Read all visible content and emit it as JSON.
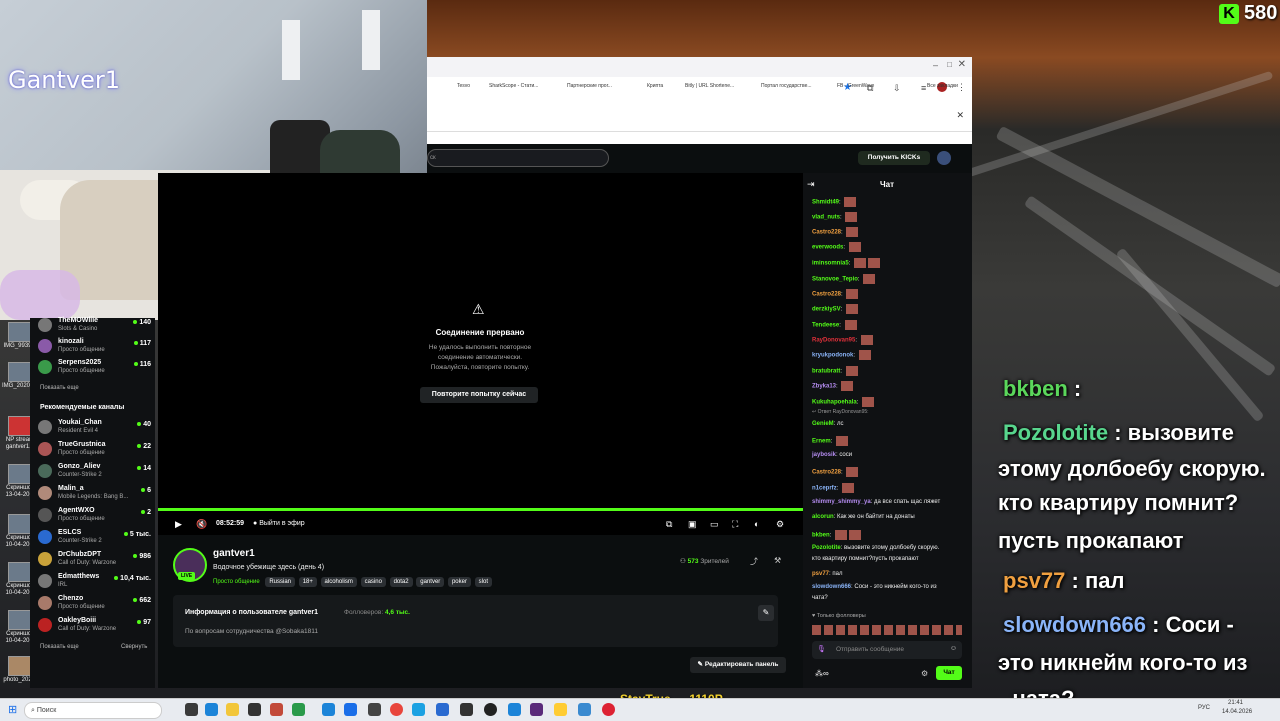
{
  "overlay": {
    "streamer_name": "Gantver1",
    "kick_counter": "580",
    "ticker_text": "StayTrue — 1110P",
    "chat": [
      {
        "user": "bkben",
        "sep": " : ",
        "text": "",
        "color": "#5bd75b"
      },
      {
        "user": "Pozolotite",
        "sep": " : ",
        "text": "вызовите",
        "color": "#58d68d"
      },
      {
        "user": "",
        "sep": "",
        "text": "этому долбоебу скорую.",
        "color": "#ffffff"
      },
      {
        "user": "",
        "sep": "",
        "text": "кто квартиру помнит?",
        "color": "#ffffff"
      },
      {
        "user": "",
        "sep": "",
        "text": "пусть прокапают",
        "color": "#ffffff"
      },
      {
        "user": "psv77",
        "sep": " : ",
        "text": "пал",
        "color": "#f0a040"
      },
      {
        "user": "slowdown666",
        "sep": " : ",
        "text": "Соси -",
        "color": "#8ab4f8"
      },
      {
        "user": "",
        "sep": "",
        "text": "это никнейм кого-то из",
        "color": "#ffffff"
      },
      {
        "user": "",
        "sep": "",
        "text": "чата?",
        "color": "#ffffff"
      }
    ]
  },
  "desktop_icons": [
    "IMG_9939...",
    "IMG_20200...",
    "NP stream gantver1...",
    "Скриншот 13-04-20...",
    "Скриншот 10-04-20...",
    "Скриншот 10-04-20...",
    "Скриншот 10-04-20...",
    "photo_202..."
  ],
  "browser": {
    "bookmarks": [
      "Tesvo",
      "SharkScope - Стати...",
      "Партнерские прог...",
      "Крипта",
      "Bitly | URL Shortene...",
      "Портал государстве...",
      "FB - GreenWave",
      "Все закладки"
    ],
    "search_placeholder": "ск",
    "get_kicks_button": "Получить KICKs"
  },
  "sidebar": {
    "channels_top": [
      {
        "name": "TheMOWliie",
        "category": "Slots & Casino",
        "viewers": "140"
      },
      {
        "name": "kinozali",
        "category": "Просто общение",
        "viewers": "117"
      },
      {
        "name": "Serpens2025",
        "category": "Просто общение",
        "viewers": "116"
      }
    ],
    "show_more": "Показать еще",
    "recommended_title": "Рекомендуемые каналы",
    "recommended": [
      {
        "name": "Youkai_Chan",
        "category": "Resident Evil 4",
        "viewers": "40"
      },
      {
        "name": "TrueGrustnica",
        "category": "Просто общение",
        "viewers": "22"
      },
      {
        "name": "Gonzo_Aliev",
        "category": "Counter-Strike 2",
        "viewers": "14"
      },
      {
        "name": "Malin_a",
        "category": "Mobile Legends: Bang B...",
        "viewers": "6"
      },
      {
        "name": "AgentWXO",
        "category": "Просто общение",
        "viewers": "2"
      },
      {
        "name": "ESLCS",
        "category": "Counter-Strike 2",
        "viewers": "5 тыс."
      },
      {
        "name": "DrChubzDPT",
        "category": "Call of Duty: Warzone",
        "viewers": "986"
      },
      {
        "name": "Edmatthews",
        "category": "IRL",
        "viewers": "10,4 тыс."
      },
      {
        "name": "Chenzo",
        "category": "Просто общение",
        "viewers": "662"
      },
      {
        "name": "OakleyBoiii",
        "category": "Call of Duty: Warzone",
        "viewers": "97"
      }
    ],
    "show_more_2": "Показать еще",
    "collapse": "Свернуть"
  },
  "player": {
    "error_title": "Соединение прервано",
    "error_body": [
      "Не удалось выполнить повторное",
      "соединение автоматически.",
      "Пожалуйста, повторите попытку."
    ],
    "retry_button": "Повторите попытку сейчас",
    "time": "08:52:59",
    "go_live": "Выйти в эфир"
  },
  "stream_info": {
    "channel": "gantver1",
    "title": "Водочное убежище здесь (день 4)",
    "live_badge": "LIVE",
    "category": "Просто общение",
    "tags": [
      "Russian",
      "18+",
      "alcoholism",
      "casino",
      "dota2",
      "gantver",
      "poker",
      "slot"
    ],
    "viewers": "573",
    "viewers_label": "Зрителей"
  },
  "about": {
    "title": "Информация о пользователе gantver1",
    "followers_label": "Фолловеров:",
    "followers": "4,6 тыс.",
    "desc": "По вопросам сотрудничества @Sobaka1811",
    "edit_panel": "Редактировать панель"
  },
  "chat": {
    "title": "Чат",
    "messages": [
      {
        "user": "Shmidt49",
        "text": "",
        "color": "#53fc18"
      },
      {
        "user": "vlad_nuts",
        "text": "",
        "color": "#53fc18"
      },
      {
        "user": "Castro228",
        "text": "",
        "color": "#f0a040"
      },
      {
        "user": "everwoods",
        "text": "",
        "color": "#53fc18"
      },
      {
        "user": "iminsomnia5",
        "text": "",
        "color": "#53fc18"
      },
      {
        "user": "Stanovoe_Tepio",
        "text": "",
        "color": "#53fc18"
      },
      {
        "user": "Castro228",
        "text": "",
        "color": "#f0a040"
      },
      {
        "user": "derzkiySV",
        "text": "",
        "color": "#53fc18"
      },
      {
        "user": "Tendeese",
        "text": "",
        "color": "#53fc18"
      },
      {
        "user": "RayDonovan95",
        "text": "",
        "color": "#e0303a"
      },
      {
        "user": "kryukpodonok",
        "text": "",
        "color": "#8ab4f8"
      },
      {
        "user": "bratubratt",
        "text": "",
        "color": "#53fc18"
      },
      {
        "user": "Zbyka13",
        "text": "",
        "color": "#b48cf0"
      },
      {
        "user": "Kukuhapoehala",
        "text": "",
        "color": "#53fc18"
      },
      {
        "user": "GenieM",
        "text": "лс",
        "color": "#53fc18"
      },
      {
        "user": "Ernem",
        "text": "",
        "color": "#53fc18"
      },
      {
        "user": "jaybosik",
        "text": "соси",
        "color": "#b48cf0"
      },
      {
        "user": "Castro228",
        "text": "",
        "color": "#f0a040"
      },
      {
        "user": "n1ceprfz",
        "text": "",
        "color": "#8ab4f8"
      },
      {
        "user": "shimmy_shimmy_ya",
        "text": "да все спать щас ляжет",
        "color": "#b48cf0"
      },
      {
        "user": "alcorun",
        "text": "Как же он байтит на донаты",
        "color": "#53fc18"
      },
      {
        "user": "bkben",
        "text": "",
        "color": "#53fc18"
      },
      {
        "user": "Pozolotite",
        "text": "вызовите этому долбоебу скорую.",
        "color": "#53fc18"
      },
      {
        "user": "",
        "text": "кто квартиру помнит?пусть прокапают",
        "color": "#eeeeee"
      },
      {
        "user": "psv77",
        "text": "пал",
        "color": "#f0a040"
      },
      {
        "user": "slowdown666",
        "text": "Соси - это никнейм кого-то из",
        "color": "#8ab4f8"
      },
      {
        "user": "",
        "text": "чата?",
        "color": "#eeeeee"
      }
    ],
    "reply_note": "Ответ RayDonovan95:",
    "followers_only": "Только фолловеры",
    "input_placeholder": "Отправить сообщение",
    "send_button": "Чат",
    "infinity": "∞"
  },
  "taskbar": {
    "search_placeholder": "Поиск",
    "lang": "РУС",
    "time": "21:41",
    "date": "14.04.2026"
  },
  "colors": {
    "kick_green": "#53fc18",
    "page_bg": "#0b0e0f"
  }
}
